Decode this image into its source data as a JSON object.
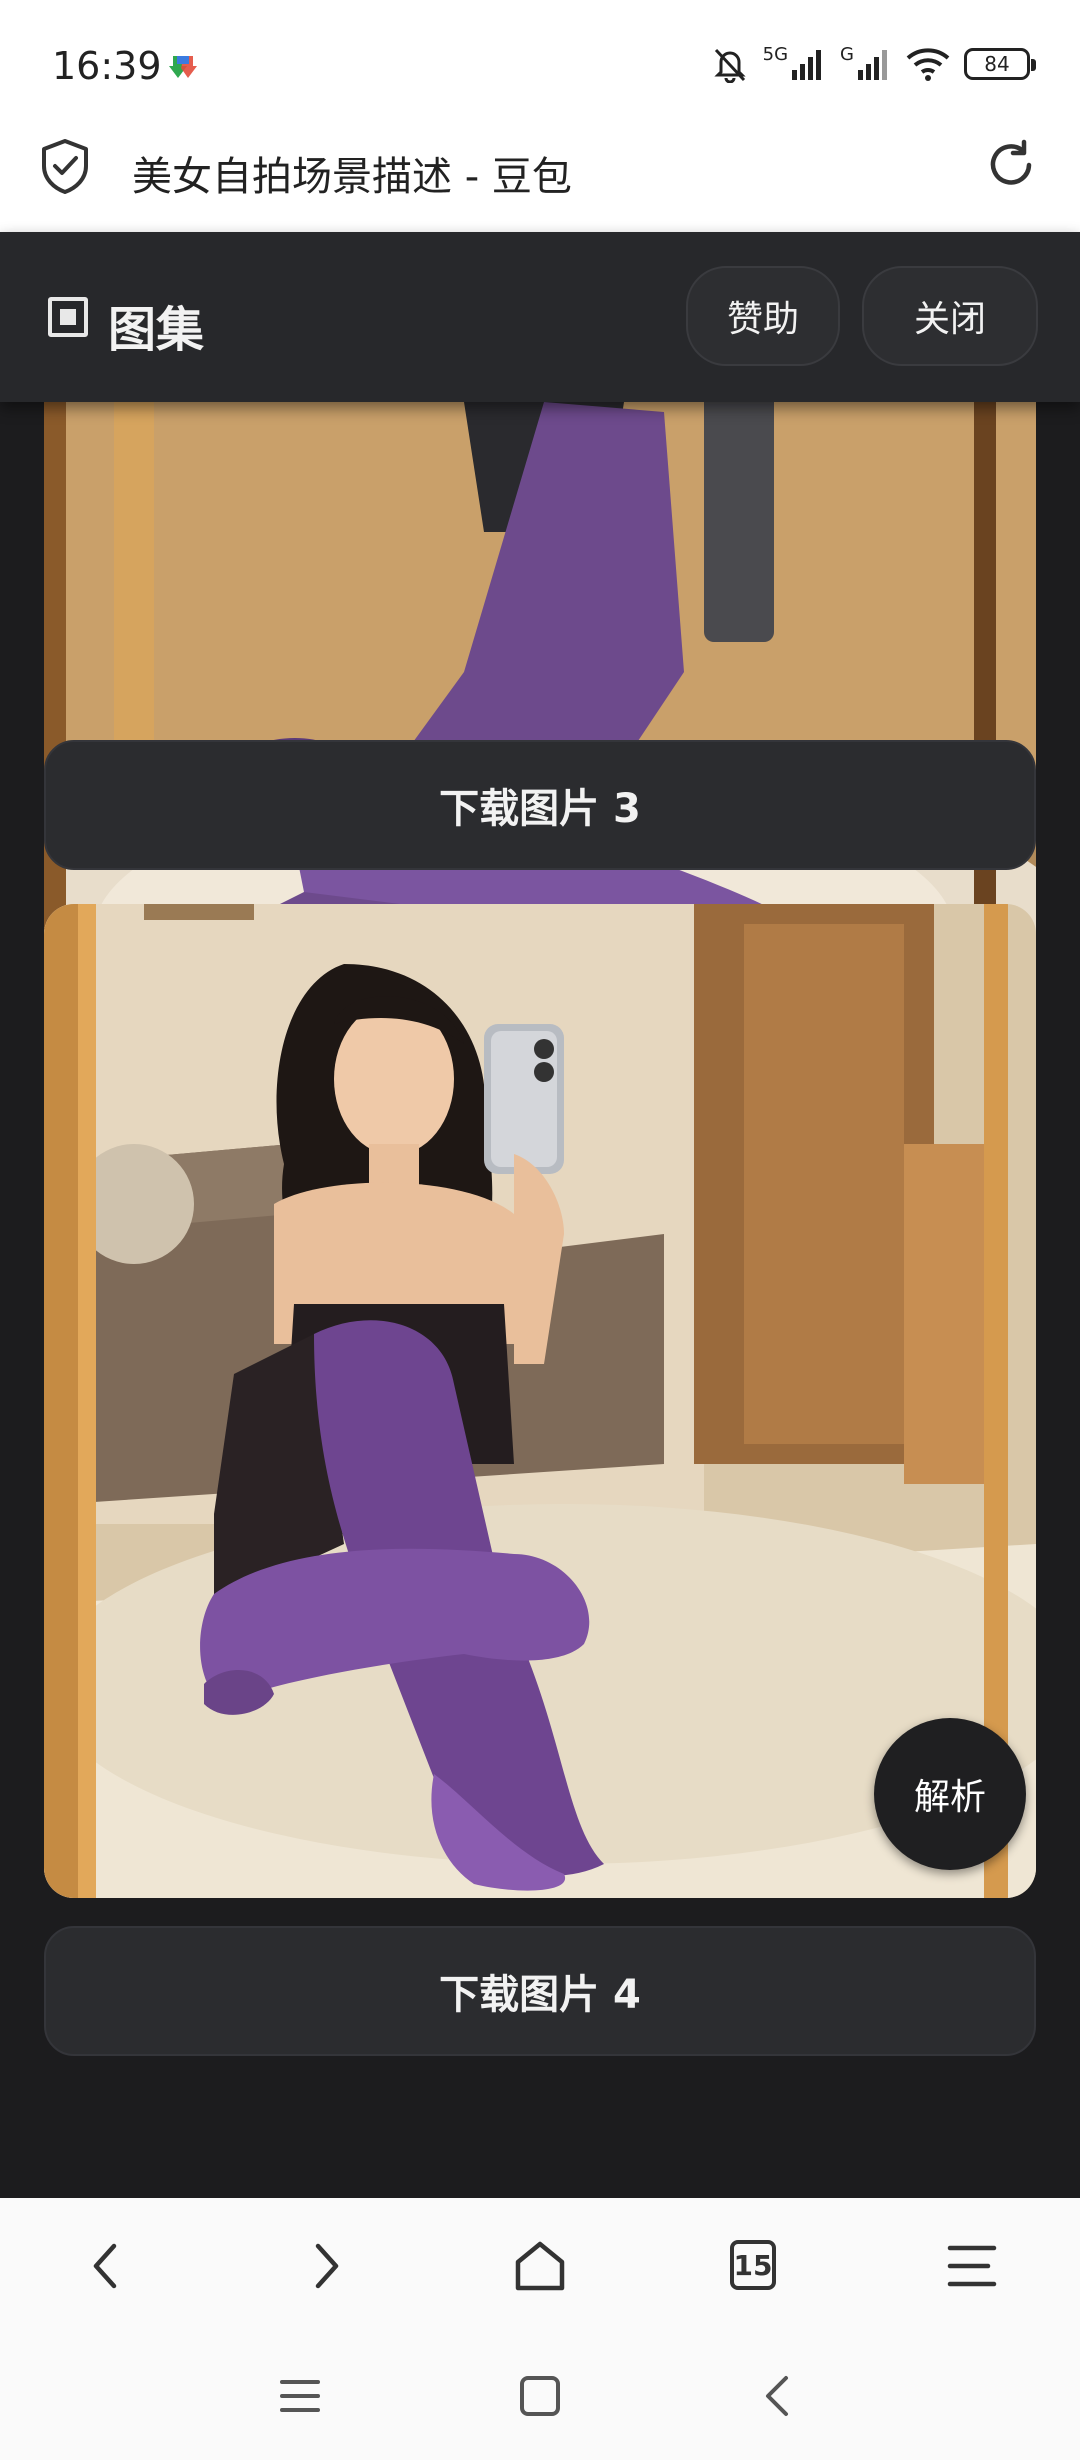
{
  "status_bar": {
    "time": "16:39",
    "network_5g": "5G",
    "network_g": "G",
    "battery": "84"
  },
  "title_bar": {
    "title": "美女自拍场景描述 - 豆包"
  },
  "gallery": {
    "title": "图集",
    "sponsor_label": "赞助",
    "close_label": "关闭",
    "items": [
      {
        "download_label": "下载图片 3"
      },
      {
        "download_label": "下载图片 4"
      }
    ],
    "parse_label": "解析"
  },
  "browser_nav": {
    "tab_count": "15"
  },
  "colors": {
    "gallery_bg": "#1c1c1e",
    "header_bg": "#27282b",
    "button_bg": "#2b2c2f",
    "stocking_purple": "#6a3d8f"
  }
}
